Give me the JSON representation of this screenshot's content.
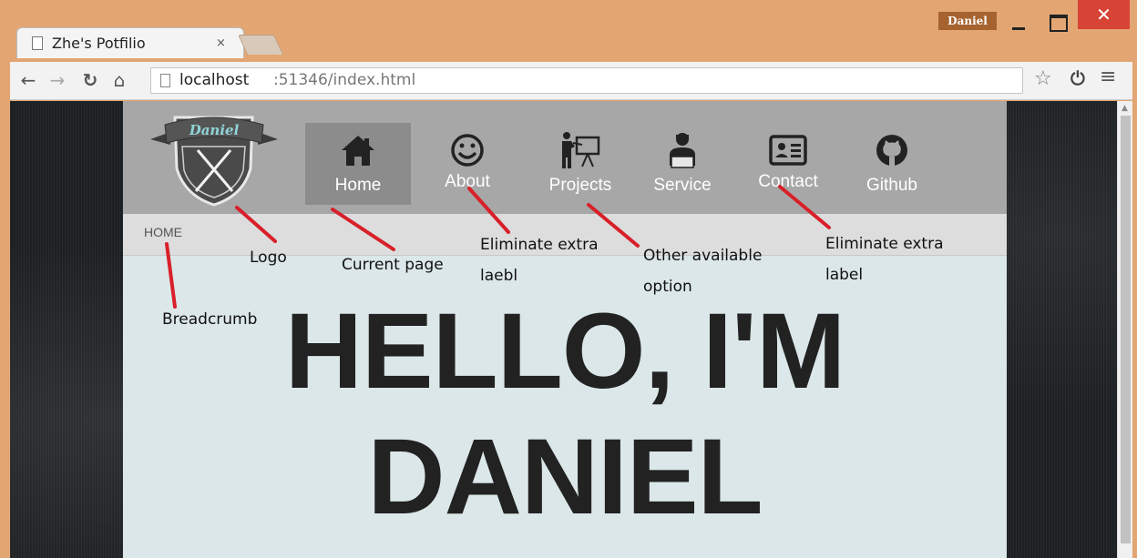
{
  "browser": {
    "tab_title": "Zhe's Potfilio",
    "tab_close": "×",
    "profile_name": "Daniel",
    "close_glyph": "✕",
    "url_host": "localhost",
    "url_path": ":51346/index.html",
    "icons": [
      "back-icon",
      "forward-icon",
      "reload-icon",
      "home-icon",
      "page-icon",
      "star-icon",
      "power-icon",
      "menu-icon"
    ]
  },
  "site": {
    "logo_text": "Daniel",
    "nav": [
      {
        "label": "Home",
        "icon": "house-icon",
        "active": true
      },
      {
        "label": "About",
        "icon": "smiley-icon",
        "active": false
      },
      {
        "label": "Projects",
        "icon": "presenter-icon",
        "active": false
      },
      {
        "label": "Service",
        "icon": "person-icon",
        "active": false
      },
      {
        "label": "Contact",
        "icon": "id-card-icon",
        "active": false
      },
      {
        "label": "Github",
        "icon": "github-icon",
        "active": false
      }
    ],
    "breadcrumb": "HOME",
    "hero_line1": "HELLO, I'M",
    "hero_line2": "DANIEL"
  },
  "annotations": {
    "logo": "Logo",
    "current_page": "Current page",
    "eliminate_1a": "Eliminate extra",
    "eliminate_1b": "laebl",
    "other_option_a": "Other available",
    "other_option_b": "option",
    "eliminate_2a": "Eliminate extra",
    "eliminate_2b": "label",
    "breadcrumb": "Breadcrumb",
    "line_color": "#d8202a"
  }
}
